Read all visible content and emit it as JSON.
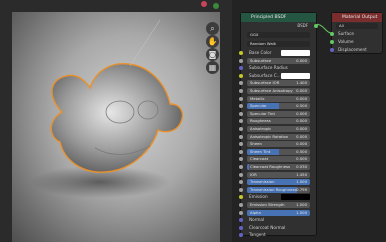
{
  "viewport": {
    "tools": [
      "zoom-icon",
      "hand-icon",
      "camera-icon",
      "grid-icon"
    ]
  },
  "bsdf_node": {
    "title": "Principled BSDF",
    "output_label": "BSDF",
    "distribution": "GGX",
    "subsurface_method": "Random Walk",
    "rows": [
      {
        "type": "color",
        "label": "Base Color",
        "socket": "y",
        "swatch": "#ffffff"
      },
      {
        "type": "slider",
        "label": "Subsurface",
        "value": "0.000",
        "fill": 0
      },
      {
        "type": "plain",
        "label": "Subsurface Radius",
        "socket": "p"
      },
      {
        "type": "color",
        "label": "Subsurface C...",
        "socket": "y",
        "swatch": "#ffffff"
      },
      {
        "type": "slider",
        "label": "Subsurface IOR",
        "value": "1.400",
        "fill": 0
      },
      {
        "type": "slider",
        "label": "Subsurface Anisotropy",
        "value": "0.000",
        "fill": 0
      },
      {
        "type": "slider",
        "label": "Metallic",
        "value": "0.000",
        "fill": 0
      },
      {
        "type": "slider",
        "label": "Specular",
        "value": "0.500",
        "fill": 0.5
      },
      {
        "type": "slider",
        "label": "Specular Tint",
        "value": "0.000",
        "fill": 0
      },
      {
        "type": "slider",
        "label": "Roughness",
        "value": "0.000",
        "fill": 0
      },
      {
        "type": "slider",
        "label": "Anisotropic",
        "value": "0.000",
        "fill": 0
      },
      {
        "type": "slider",
        "label": "Anisotropic Rotation",
        "value": "0.000",
        "fill": 0
      },
      {
        "type": "slider",
        "label": "Sheen",
        "value": "0.000",
        "fill": 0
      },
      {
        "type": "slider",
        "label": "Sheen Tint",
        "value": "0.500",
        "fill": 0.5
      },
      {
        "type": "slider",
        "label": "Clearcoat",
        "value": "0.000",
        "fill": 0
      },
      {
        "type": "slider",
        "label": "Clearcoat Roughness",
        "value": "0.030",
        "fill": 0.03
      },
      {
        "type": "slider",
        "label": "IOR",
        "value": "1.450",
        "fill": 0
      },
      {
        "type": "slider",
        "label": "Transmission",
        "value": "1.000",
        "fill": 1
      },
      {
        "type": "slider",
        "label": "Transmission Roughness",
        "value": "0.799",
        "fill": 0.8
      },
      {
        "type": "color",
        "label": "Emission",
        "socket": "y",
        "swatch": "#000000"
      },
      {
        "type": "slider",
        "label": "Emission Strength",
        "value": "1.000",
        "fill": 0
      },
      {
        "type": "slider",
        "label": "Alpha",
        "value": "1.000",
        "fill": 1
      },
      {
        "type": "plain",
        "label": "Normal",
        "socket": "p"
      },
      {
        "type": "plain",
        "label": "Clearcoat Normal",
        "socket": "p"
      },
      {
        "type": "plain",
        "label": "Tangent",
        "socket": "p"
      }
    ]
  },
  "output_node": {
    "title": "Material Output",
    "target": "All",
    "inputs": [
      "Surface",
      "Volume",
      "Displacement"
    ]
  },
  "colors": {
    "shader_header": "#245641",
    "output_header": "#7a2d2d",
    "slider_fill": "#4772b3",
    "selection_outline": "#e8912c"
  }
}
